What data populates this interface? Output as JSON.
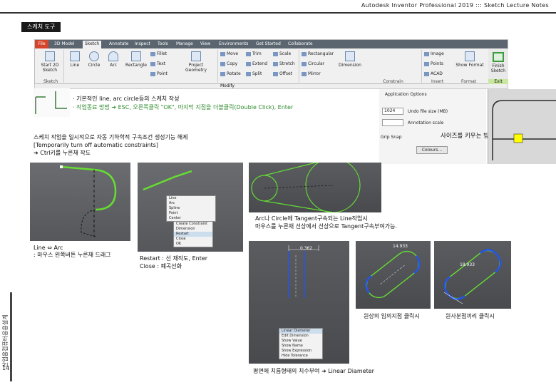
{
  "header": {
    "title": "Autodesk Inventor Professional 2019 ::: Sketch Lecture Notes"
  },
  "section": {
    "label": "스케치 도구"
  },
  "ribbon": {
    "file_tab": "File",
    "tabs": [
      "3D Model",
      "Sketch",
      "Annotate",
      "Inspect",
      "Tools",
      "Manage",
      "View",
      "Environments",
      "Get Started",
      "Collaborate"
    ],
    "active_tab": "Sketch",
    "tools": {
      "start": "Start 2D Sketch",
      "line": "Line",
      "circle": "Circle",
      "arc": "Arc",
      "rectangle": "Rectangle",
      "fillet": "Fillet",
      "text": "Text",
      "point": "Point",
      "project": "Project Geometry",
      "move": "Move",
      "copy": "Copy",
      "rotate": "Rotate",
      "trim": "Trim",
      "extend": "Extend",
      "split": "Split",
      "scale": "Scale",
      "stretch": "Stretch",
      "offset": "Offset",
      "rect_pattern": "Rectangular",
      "circ_pattern": "Circular",
      "mirror": "Mirror",
      "dimension": "Dimension",
      "image": "Image",
      "points": "Points",
      "acad": "ACAD",
      "show_format": "Show Format",
      "finish": "Finish Sketch",
      "exit": "Exit"
    },
    "groups": {
      "sketch": "Sketch",
      "constrain": "Constrain",
      "insert": "Insert",
      "format": "Format",
      "modify": "Modify"
    }
  },
  "notes": {
    "n1": "· 기본적인 line, arc circle등의 스케치 작성",
    "n2": "· 작업종료 방법 ➔ ESC, 오른쪽클릭 \"OK\", 마지막 지점을 더블클릭(Double Click), Enter",
    "n3": "스케치 작업을 일시적으로 자동 기하학적 구속조건 생성기능 해제",
    "n4": "[Temporarily turn off automatic constraints]",
    "n5": "➔ Ctrl키를 누른채 작도",
    "size_tip": "사이즈를 키우는 방법",
    "tangent1": "Arc나 Circle에 Tangent구속되는 Line작업시",
    "tangent2": "마우스를 누른채 선상에서 선상으로 Tangent구속부여가능.",
    "linearc1": "Line ⇔ Arc",
    "linearc2": ": 마우스 왼쪽버튼 누른채 드래그",
    "restart1": "Restart : 선 재작도, Enter",
    "restart2": "Close : 폐곡선화",
    "circle_click": "원상의 임의지점 클릭시",
    "half_click": "원사분점끼리 클릭시",
    "linear_dia": "평면에 치름형태의 치수부여 ➔ Linear Diameter"
  },
  "dialog": {
    "title": "Application Options",
    "value": "1024",
    "label1": "Undo file size (MB)",
    "label2": "Annotation scale",
    "snap": "Grip Snap",
    "button": "Colours..."
  },
  "sidebar": {
    "text": "산업용컴퓨터응용설계",
    "page": "14"
  },
  "dim": {
    "d1": "0.362",
    "d2": "14.933",
    "d3": "18.933"
  },
  "menu": {
    "items": [
      "Line",
      "Arc",
      "Spline",
      "Point",
      "Center",
      "Create Constraint",
      "Dimension",
      "Restart",
      "Close",
      "OK"
    ],
    "linear": [
      "Linear Diameter",
      "Edit Dimension",
      "Show Value",
      "Show Name",
      "Show Expression",
      "Hide Tolerance"
    ]
  },
  "colors": {
    "accent": "#2e8b2e",
    "section_bg": "#1a1a1a",
    "highlight": "#ffff00"
  }
}
